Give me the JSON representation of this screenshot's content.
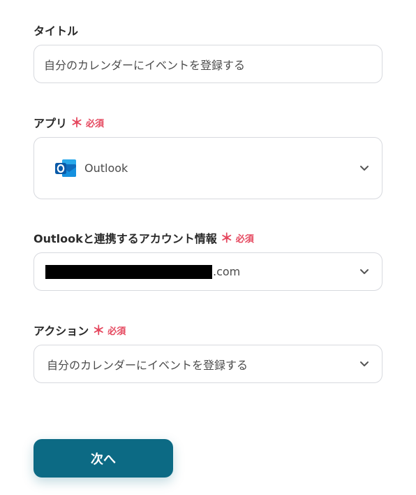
{
  "title_section": {
    "label": "タイトル",
    "value": "自分のカレンダーにイベントを登録する"
  },
  "app_section": {
    "label": "アプリ",
    "required_mark": "＊",
    "required_text": "必須",
    "selected_app": "Outlook",
    "app_icon": "outlook-logo-icon"
  },
  "account_section": {
    "label": "Outlookと連携するアカウント情報",
    "required_mark": "＊",
    "required_text": "必須",
    "value_suffix": ".com"
  },
  "action_section": {
    "label": "アクション",
    "required_mark": "＊",
    "required_text": "必須",
    "selected_action": "自分のカレンダーにイベントを登録する"
  },
  "next_button": {
    "label": "次へ"
  },
  "colors": {
    "accent": "#0c6a84",
    "required": "#e5475e",
    "border": "#d7d9de",
    "outlook_blue": "#0f6cbd"
  }
}
